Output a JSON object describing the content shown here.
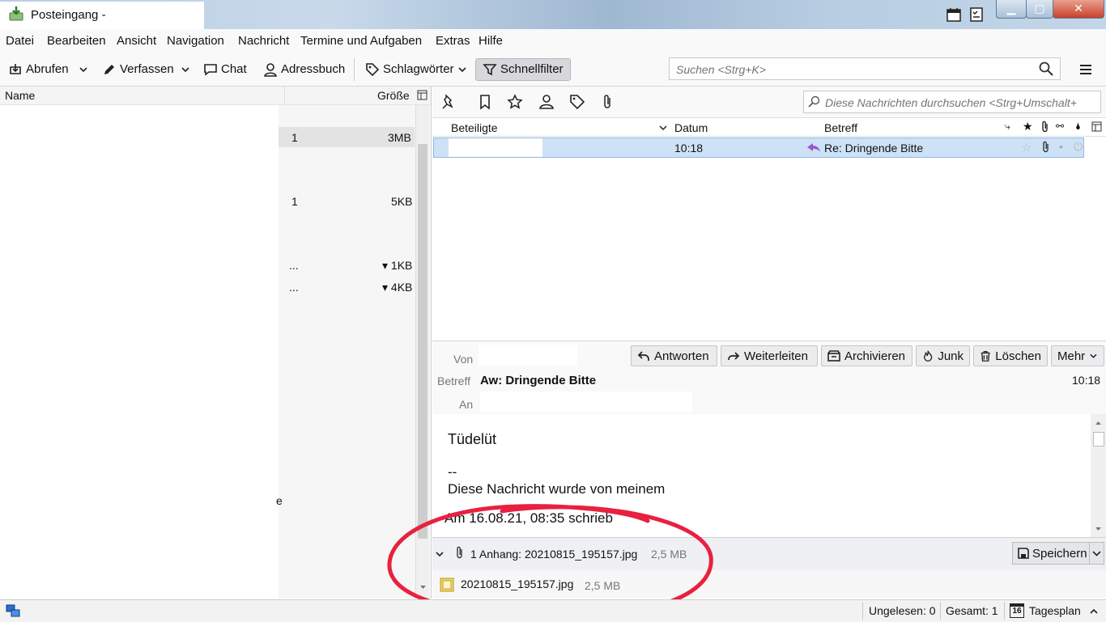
{
  "window": {
    "title": "Posteingang -",
    "controls": {
      "minimize": "▁",
      "maximize": "▢",
      "close": "✕"
    }
  },
  "menu": [
    "Datei",
    "Bearbeiten",
    "Ansicht",
    "Navigation",
    "Nachricht",
    "Termine und Aufgaben",
    "Extras",
    "Hilfe"
  ],
  "toolbar": {
    "fetch": "Abrufen",
    "compose": "Verfassen",
    "chat": "Chat",
    "addressbook": "Adressbuch",
    "tags": "Schlagwörter",
    "quickfilter": "Schnellfilter",
    "search_placeholder": "Suchen <Strg+K>"
  },
  "folder_pane": {
    "col_name": "Name",
    "col_size": "Größe",
    "rows": [
      {
        "count": "1",
        "size": "3MB",
        "selected": true
      },
      {
        "count": "1",
        "size": "5KB"
      },
      {
        "count": "...",
        "size": "▾ 1KB"
      },
      {
        "count": "...",
        "size": "▾ 4KB"
      }
    ],
    "stray_char": "e"
  },
  "thread_pane": {
    "filter_placeholder": "Diese Nachrichten durchsuchen <Strg+Umschalt+",
    "col_correspondents": "Beteiligte",
    "col_date": "Datum",
    "col_subject": "Betreff",
    "message": {
      "date": "10:18",
      "subject": "Re:  Dringende Bitte"
    }
  },
  "message_header": {
    "buttons": {
      "reply": "Antworten",
      "forward": "Weiterleiten",
      "archive": "Archivieren",
      "junk": "Junk",
      "delete": "Löschen",
      "more": "Mehr"
    },
    "label_from": "Von",
    "label_subject": "Betreff",
    "label_to": "An",
    "subject": "Aw: Dringende Bitte",
    "time": "10:18"
  },
  "message_body": {
    "line1": "Tüdelüt",
    "line2": "--",
    "line3": "Diese Nachricht wurde von meinem",
    "line4": "Am 16.08.21, 08:35 schrieb"
  },
  "attachments": {
    "summary": "1 Anhang: 20210815_195157.jpg",
    "summary_size": "2,5 MB",
    "save": "Speichern",
    "file_name": "20210815_195157.jpg",
    "file_size": "2,5 MB"
  },
  "statusbar": {
    "unread": "Ungelesen: 0",
    "total": "Gesamt: 1",
    "today_pane": "Tagesplan",
    "calendar_day": "16"
  },
  "colors": {
    "selection": "#cde2f7",
    "annotation_circle": "#e8213f"
  }
}
